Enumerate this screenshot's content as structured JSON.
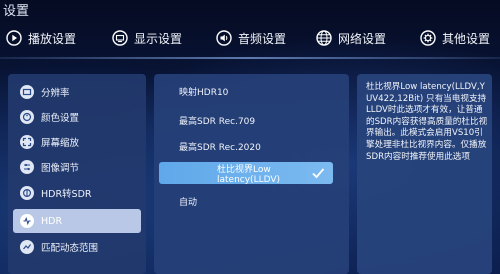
{
  "title": "设置",
  "tabs": [
    {
      "label": "播放设置",
      "icon": "play-icon"
    },
    {
      "label": "显示设置",
      "icon": "display-icon"
    },
    {
      "label": "音频设置",
      "icon": "speaker-icon"
    },
    {
      "label": "网络设置",
      "icon": "globe-icon"
    },
    {
      "label": "其他设置",
      "icon": "gear-icon"
    }
  ],
  "menu": [
    {
      "label": "分辨率",
      "icon": "resolution-icon"
    },
    {
      "label": "颜色设置",
      "icon": "palette-icon"
    },
    {
      "label": "屏幕缩放",
      "icon": "zoom-icon"
    },
    {
      "label": "图像调节",
      "icon": "image-adjust-icon"
    },
    {
      "label": "HDR转SDR",
      "icon": "hdr-sdr-icon"
    },
    {
      "label": "HDR",
      "icon": "hdr-icon",
      "selected": true
    },
    {
      "label": "匹配动态范围",
      "icon": "dynamic-range-icon"
    }
  ],
  "options": [
    {
      "label": "映射HDR10"
    },
    {
      "label": "最高SDR Rec.709"
    },
    {
      "label": "最高SDR Rec.2020"
    },
    {
      "label": "杜比视界Low latency(LLDV)",
      "selected": true
    },
    {
      "label": "自动"
    }
  ],
  "description": "杜比视界Low latency(LLDV,YUV422,12Bit) 只有当电视支持LLDV时此选项才有效，让普通的SDR内容获得高质量的杜比视界输出。此模式会启用VS10引擎处理非杜比视界内容。仅播放SDR内容时推荐使用此选项",
  "colors": {
    "accent": "#6fb2ee",
    "selected_menu": "#b9c8e6",
    "panel": "#26407a"
  }
}
